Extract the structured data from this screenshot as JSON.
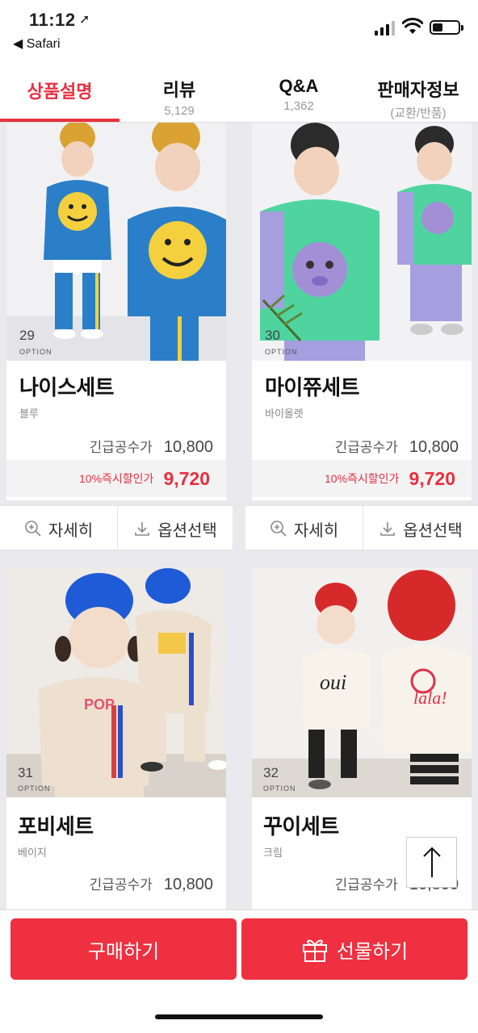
{
  "status": {
    "time": "11:12",
    "back_label": "◀ Safari"
  },
  "tabs": [
    {
      "label": "상품설명",
      "sub": ""
    },
    {
      "label": "리뷰",
      "sub": "5,129"
    },
    {
      "label": "Q&A",
      "sub": "1,362"
    },
    {
      "label": "판매자정보",
      "sub": "(교환/반품)"
    }
  ],
  "products": [
    {
      "num": "29",
      "option": "OPTION",
      "name": "나이스세트",
      "color": "블루",
      "price_label": "긴급공수가",
      "price": "10,800",
      "discount_label": "10%즉시할인가",
      "discount_price": "9,720"
    },
    {
      "num": "30",
      "option": "OPTION",
      "name": "마이쮸세트",
      "color": "바이올렛",
      "price_label": "긴급공수가",
      "price": "10,800",
      "discount_label": "10%즉시할인가",
      "discount_price": "9,720"
    },
    {
      "num": "31",
      "option": "OPTION",
      "name": "포비세트",
      "color": "베이지",
      "price_label": "긴급공수가",
      "price": "10,800"
    },
    {
      "num": "32",
      "option": "OPTION",
      "name": "꾸이세트",
      "color": "크림",
      "price_label": "긴급공수가",
      "price": "10,800"
    }
  ],
  "actions": {
    "detail_label": "자세히",
    "option_label": "옵션선택"
  },
  "bottom": {
    "buy_label": "구매하기",
    "gift_label": "선물하기"
  },
  "colors": {
    "accent": "#e8303f",
    "button": "#ee3040"
  }
}
